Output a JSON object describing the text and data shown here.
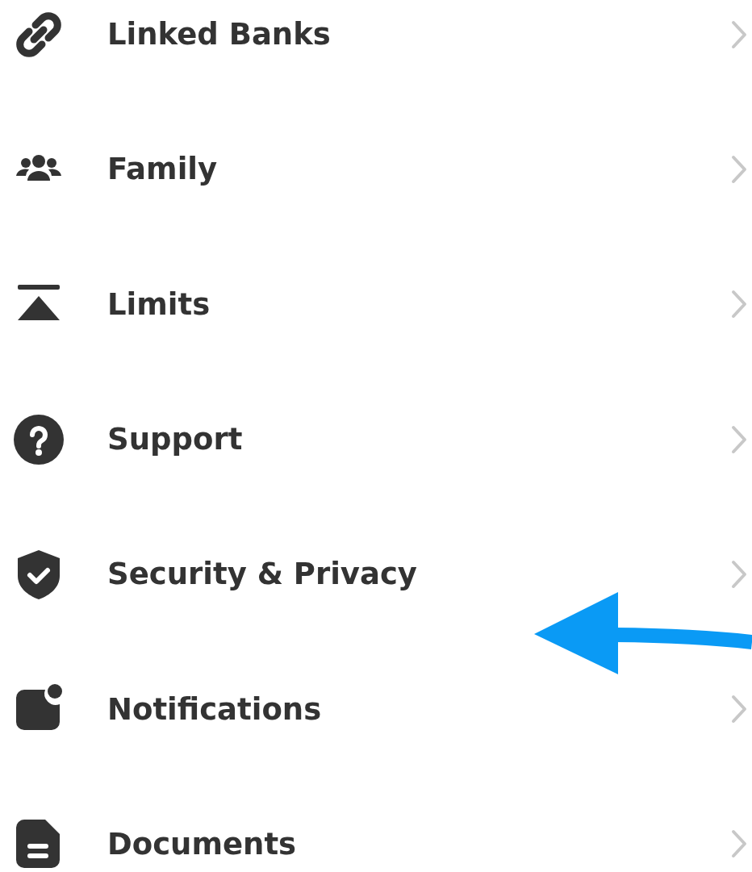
{
  "menu_items": [
    {
      "label": "Linked Banks"
    },
    {
      "label": "Family"
    },
    {
      "label": "Limits"
    },
    {
      "label": "Support"
    },
    {
      "label": "Security & Privacy"
    },
    {
      "label": "Notifications"
    },
    {
      "label": "Documents"
    }
  ]
}
